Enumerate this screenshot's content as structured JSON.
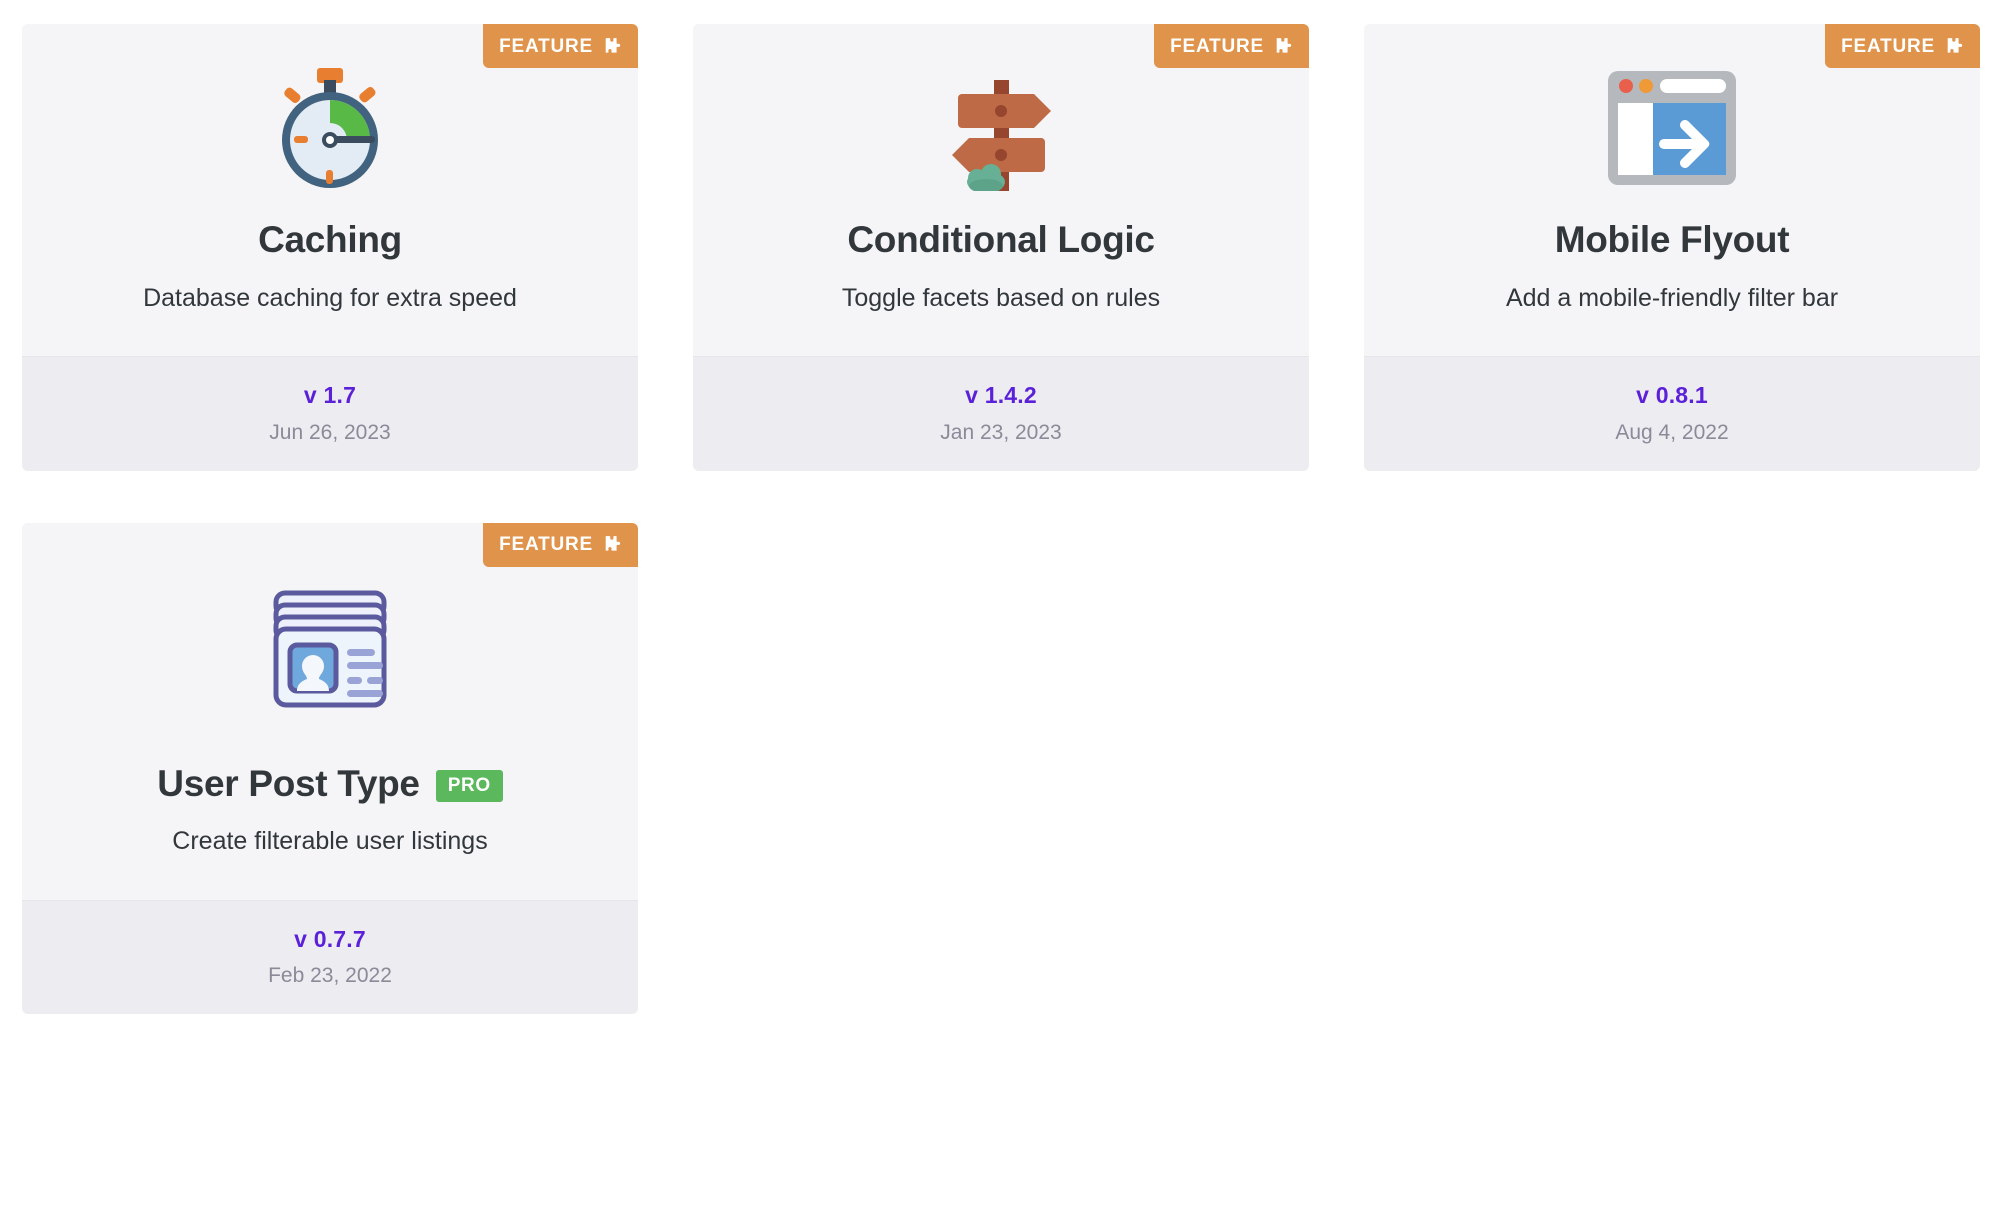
{
  "colors": {
    "badge_feature_bg": "#e0934b",
    "badge_pro_bg": "#5cb85c",
    "card_bg": "#f5f5f7",
    "footer_bg": "#edecf1",
    "version_text": "#5b21d8",
    "date_text": "#8a8a99",
    "title_text": "#32373c"
  },
  "labels": {
    "feature_badge": "FEATURE",
    "pro_badge": "PRO",
    "feature_badge_icon": "puzzle-piece-icon"
  },
  "cards": [
    {
      "icon": "stopwatch-icon",
      "title": "Caching",
      "subtitle": "Database caching for extra speed",
      "badge": "FEATURE",
      "pro": null,
      "version": "v 1.7",
      "date": "Jun 26, 2023"
    },
    {
      "icon": "signpost-icon",
      "title": "Conditional Logic",
      "subtitle": "Toggle facets based on rules",
      "badge": "FEATURE",
      "pro": null,
      "version": "v 1.4.2",
      "date": "Jan 23, 2023"
    },
    {
      "icon": "browser-flyout-icon",
      "title": "Mobile Flyout",
      "subtitle": "Add a mobile-friendly filter bar",
      "badge": "FEATURE",
      "pro": null,
      "version": "v 0.8.1",
      "date": "Aug 4, 2022"
    },
    {
      "icon": "user-card-icon",
      "title": "User Post Type",
      "subtitle": "Create filterable user listings",
      "badge": "FEATURE",
      "pro": "PRO",
      "version": "v 0.7.7",
      "date": "Feb 23, 2022"
    }
  ]
}
